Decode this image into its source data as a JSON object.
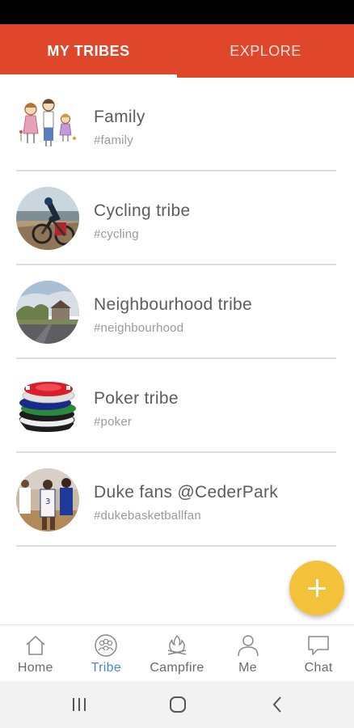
{
  "top_tabs": [
    {
      "label": "MY TRIBES",
      "active": true
    },
    {
      "label": "EXPLORE",
      "active": false
    }
  ],
  "tribes": [
    {
      "name": "Family",
      "tag": "#family",
      "avatar": "family-drawing"
    },
    {
      "name": "Cycling tribe",
      "tag": "#cycling",
      "avatar": "cyclist-photo"
    },
    {
      "name": "Neighbourhood tribe",
      "tag": "#neighbourhood",
      "avatar": "street-photo"
    },
    {
      "name": "Poker tribe",
      "tag": "#poker",
      "avatar": "poker-chips-photo"
    },
    {
      "name": "Duke fans @CederPark",
      "tag": "#dukebasketballfan",
      "avatar": "basketball-photo"
    }
  ],
  "fab": {
    "icon": "plus-icon"
  },
  "bottom_nav": [
    {
      "label": "Home",
      "icon": "home-icon",
      "active": false
    },
    {
      "label": "Tribe",
      "icon": "tribe-icon",
      "active": true
    },
    {
      "label": "Campfire",
      "icon": "campfire-icon",
      "active": false
    },
    {
      "label": "Me",
      "icon": "person-icon",
      "active": false
    },
    {
      "label": "Chat",
      "icon": "chat-icon",
      "active": false
    }
  ],
  "colors": {
    "accent": "#e0462a",
    "fab": "#f3c13a",
    "active_nav": "#4a86c8"
  }
}
